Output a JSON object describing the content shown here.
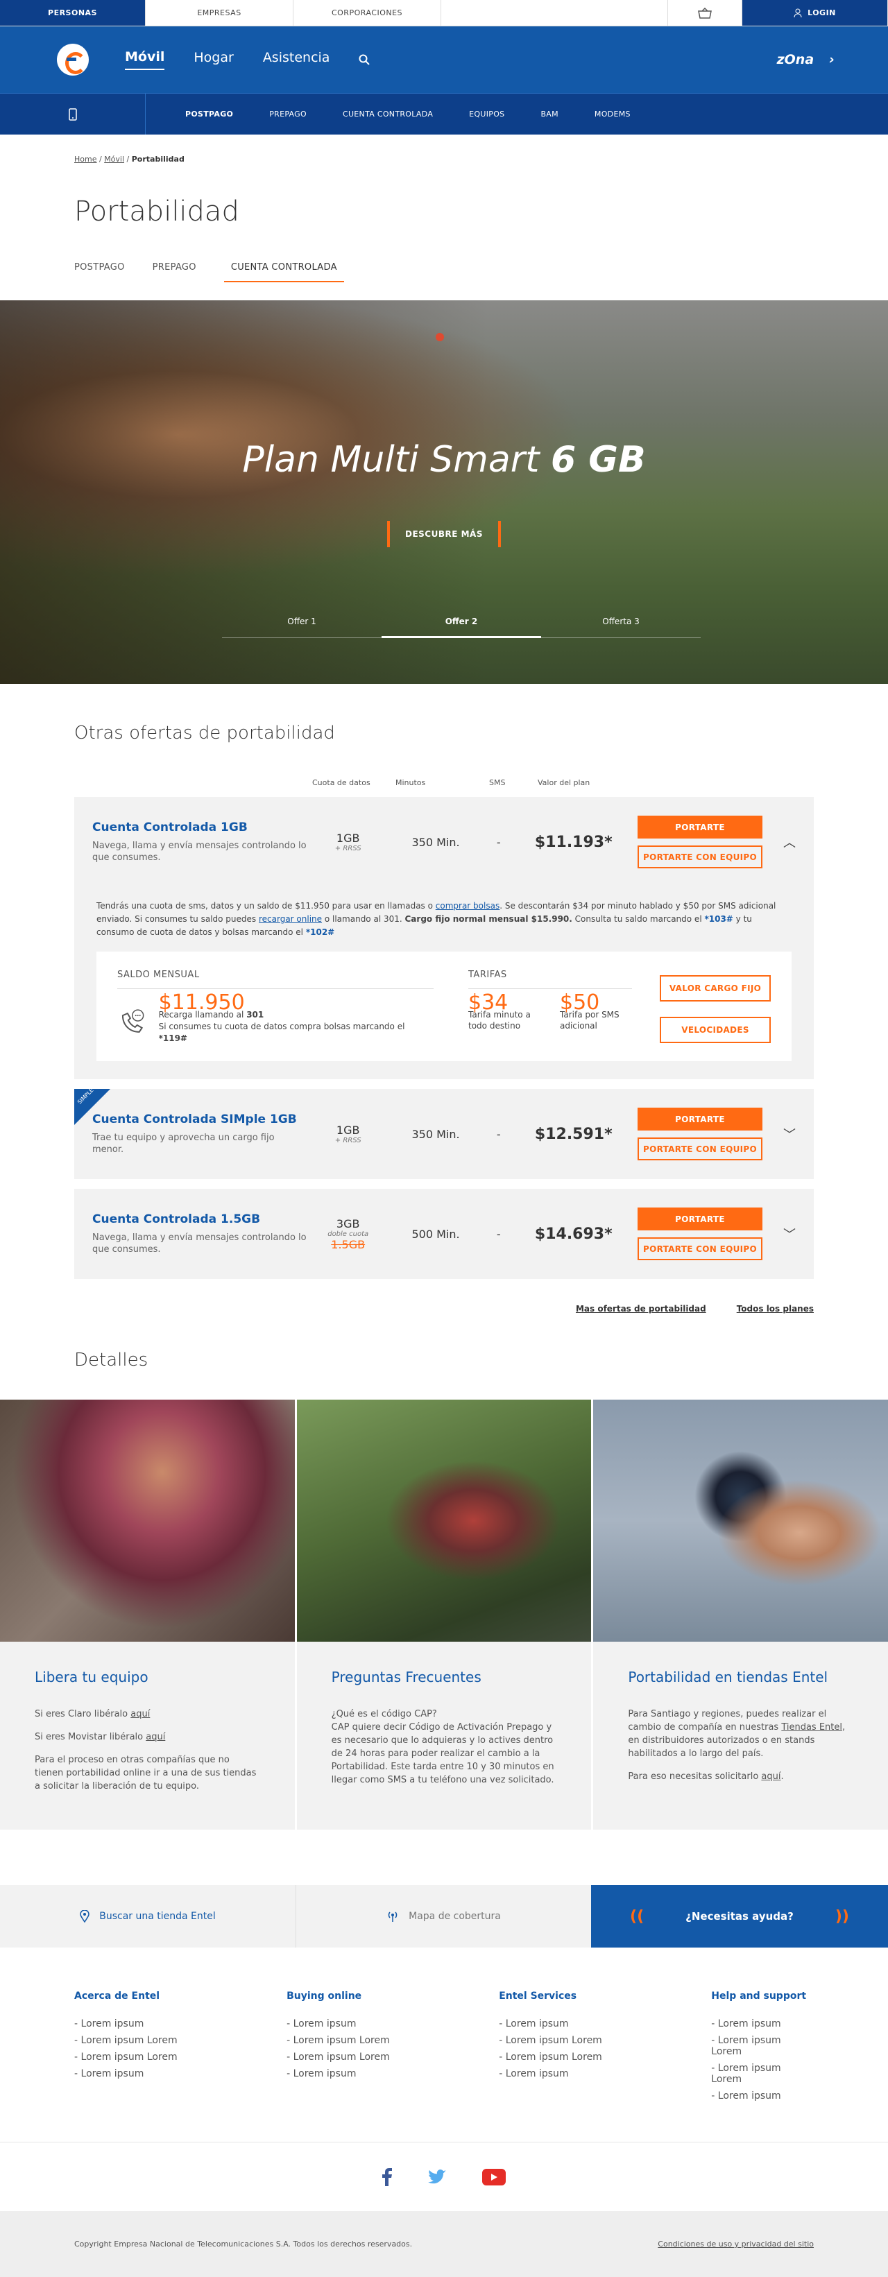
{
  "topbar": {
    "personas": "PERSONAS",
    "empresas": "EMPRESAS",
    "corporaciones": "CORPORACIONES",
    "login": "LOGIN"
  },
  "mainnav": {
    "items": [
      "Móvil",
      "Hogar",
      "Asistencia"
    ],
    "zona": "zOna"
  },
  "subnav": {
    "items": [
      "POSTPAGO",
      "PREPAGO",
      "CUENTA CONTROLADA",
      "EQUIPOS",
      "BAM",
      "MODEMS"
    ]
  },
  "breadcrumb": {
    "home": "Home",
    "movil": "Móvil",
    "current": "Portabilidad"
  },
  "page_title": "Portabilidad",
  "tabs": [
    "POSTPAGO",
    "PREPAGO",
    "CUENTA CONTROLADA"
  ],
  "hero": {
    "title": "Plan Multi Smart",
    "title_bold": "6 GB",
    "cta": "DESCUBRE MÁS",
    "offers": [
      "Offer 1",
      "Offer 2",
      "Offerta 3"
    ]
  },
  "others": {
    "title": "Otras ofertas de portabilidad",
    "headers": [
      "Cuota de datos",
      "Minutos",
      "SMS",
      "Valor del plan"
    ],
    "plans": [
      {
        "name": "Cuenta Controlada 1GB",
        "desc": "Navega, llama y envía mensajes controlando lo que consumes.",
        "data": "1GB",
        "data_note": "+ RRSS",
        "minutes": "350 Min.",
        "sms": "-",
        "price": "$11.193*"
      },
      {
        "name": "Cuenta Controlada SIMple 1GB",
        "desc": "Trae tu equipo y aprovecha un cargo fijo menor.",
        "data": "1GB",
        "data_note": "+ RRSS",
        "minutes": "350 Min.",
        "sms": "-",
        "price": "$12.591*",
        "badge": "SIMPLE"
      },
      {
        "name": "Cuenta Controlada 1.5GB",
        "desc": "Navega, llama y envía mensajes controlando lo que consumes.",
        "data": "3GB",
        "data_note": "doble cuota",
        "data_old": "1.5GB",
        "minutes": "500 Min.",
        "sms": "-",
        "price": "$14.693*"
      }
    ],
    "btn_portarte": "PORTARTE",
    "btn_equipo": "PORTARTE CON EQUIPO",
    "expanded": {
      "t1": "Tendrás una cuota de sms, datos y un saldo de $11.950 para usar en llamadas o ",
      "l1": "comprar bolsas",
      "t2": ". Se descontarán $34 por minuto hablado y $50 por SMS adicional enviado. Si consumes tu saldo puedes ",
      "l2": "recargar online",
      "t3": " o llamando al 301. ",
      "b1": "Cargo fijo normal mensual $15.990.",
      "t4": " Consulta tu saldo marcando el ",
      "c1": "*103#",
      "t5": " y tu consumo de cuota de datos y bolsas marcando el ",
      "c2": "*102#",
      "saldo_label": "SALDO MENSUAL",
      "saldo": "$11.950",
      "saldo_t1": "Recarga llamando al ",
      "saldo_b1": "301",
      "saldo_t2": "Si consumes tu cuota de datos compra bolsas marcando el ",
      "saldo_b2": "*119#",
      "tarifas_label": "TARIFAS",
      "t_min": "$34",
      "t_min_desc": "Tarifa minuto a todo destino",
      "t_sms": "$50",
      "t_sms_desc": "Tarifa por SMS adicional",
      "btn_cargo": "VALOR CARGO FIJO",
      "btn_vel": "VELOCIDADES"
    }
  },
  "links": [
    "Mas ofertas de portabilidad",
    "Todos los planes"
  ],
  "detalles": {
    "title": "Detalles",
    "cards": [
      {
        "title": "Libera tu equipo",
        "p1a": "Si eres Claro libéralo ",
        "p1l": "aquí",
        "p2a": "Si eres Movistar libéralo ",
        "p2l": "aquí",
        "p3": "Para el proceso en otras compañías que no tienen portabilidad online ir a una de sus tiendas a solicitar la liberación de tu equipo."
      },
      {
        "title": "Preguntas Frecuentes",
        "p1": "¿Qué es el código CAP?",
        "p2": "CAP quiere decir Código de Activación Prepago y es necesario que lo adquieras y lo actives dentro de 24 horas para poder realizar el cambio a la Portabilidad. Este tarda entre 10 y 30 minutos en llegar como SMS a tu teléfono una vez solicitado."
      },
      {
        "title": "Portabilidad en tiendas Entel",
        "p1a": "Para Santiago y regiones, puedes realizar el cambio de compañía en nuestras ",
        "p1l": "Tiendas Entel",
        "p1b": ", en distribuidores autorizados o en stands habilitados a lo largo del país.",
        "p2a": "Para eso necesitas solicitarlo ",
        "p2l": "aquí",
        "p2b": "."
      }
    ]
  },
  "help": {
    "tienda": "Buscar una tienda Entel",
    "mapa": "Mapa de cobertura",
    "ayuda": "¿Necesitas ayuda?"
  },
  "footer": {
    "cols": [
      {
        "title": "Acerca de Entel",
        "items": [
          "Lorem ipsum",
          "Lorem ipsum Lorem",
          "Lorem ipsum Lorem",
          "Lorem ipsum"
        ]
      },
      {
        "title": "Buying online",
        "items": [
          "Lorem ipsum",
          "Lorem ipsum Lorem",
          "Lorem ipsum Lorem",
          "Lorem ipsum"
        ]
      },
      {
        "title": "Entel Services",
        "items": [
          "Lorem ipsum",
          "Lorem ipsum Lorem",
          "Lorem ipsum Lorem",
          "Lorem ipsum"
        ]
      },
      {
        "title": "Help and support",
        "items": [
          "Lorem ipsum",
          "Lorem ipsum Lorem",
          "Lorem ipsum Lorem",
          "Lorem ipsum"
        ]
      }
    ],
    "copyright": "Copyright Empresa Nacional de Telecomunicaciones S.A. Todos los derechos reservados.",
    "terms": "Condiciones de uso y privacidad del sitio"
  },
  "colors": {
    "brand_blue": "#1359a8",
    "navy": "#0d3f8a",
    "orange": "#ff6a13"
  }
}
